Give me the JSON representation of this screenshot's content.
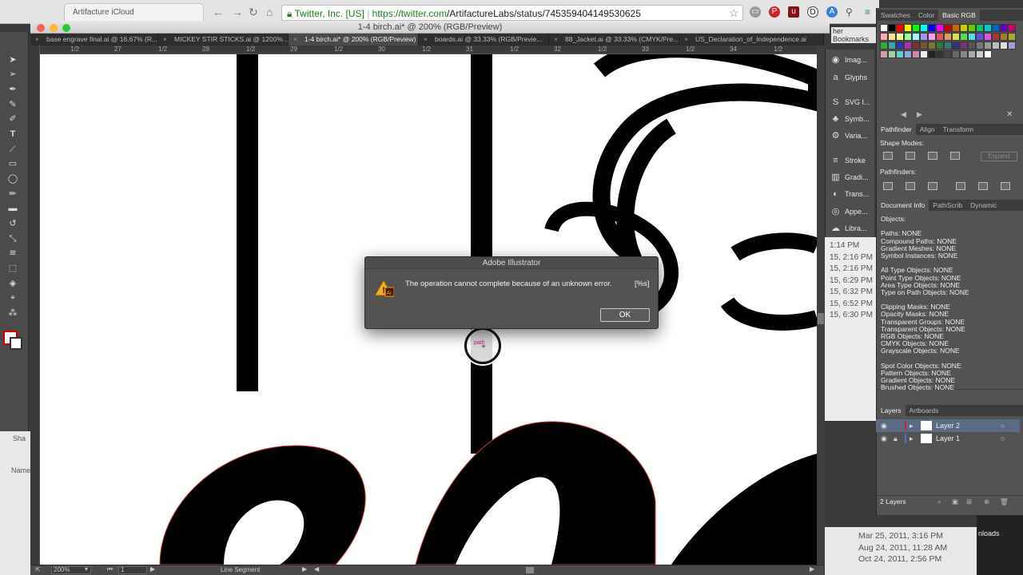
{
  "browser": {
    "tab_title": "Artifacture iCloud",
    "security_label": "Twitter, Inc. [US]",
    "url_host": "https://twitter.com",
    "url_path": "/ArtifactureLabs/status/745359404149530625",
    "bookmarks_label": "her Bookmarks"
  },
  "app": {
    "window_title": "1-4 birch.ai* @ 200% (RGB/Preview)",
    "doc_tabs": [
      {
        "label": "base engrave final.ai @ 16.67% (R...",
        "active": false
      },
      {
        "label": "MICKEY STIR STICKS.ai @ 1200% ...",
        "active": false
      },
      {
        "label": "1-4 birch.ai* @ 200% (RGB/Preview)",
        "active": true
      },
      {
        "label": "boards.ai @ 33.33% (RGB/Previe...",
        "active": false
      },
      {
        "label": "88_Jacket.ai @ 33.33% (CMYK/Pre...",
        "active": false
      },
      {
        "label": "US_Declaration_of_Independence.ai",
        "active": false
      }
    ],
    "ruler_labels": [
      "1/2",
      "27",
      "1/2",
      "28",
      "1/2",
      "29",
      "1/2",
      "30",
      "1/2",
      "31",
      "1/2",
      "32",
      "1/2",
      "33",
      "1/2",
      "34",
      "1/2"
    ]
  },
  "status": {
    "zoom": "200%",
    "artboard": "1",
    "tool_info": "Line Segment"
  },
  "collapsed_panels": [
    {
      "label": "Imag...",
      "icon": "image-icon"
    },
    {
      "label": "Glyphs",
      "icon": "glyphs-icon"
    },
    {
      "label": "SVG I...",
      "icon": "svg-icon"
    },
    {
      "label": "Symb...",
      "icon": "symbols-icon"
    },
    {
      "label": "Varia...",
      "icon": "variables-icon"
    },
    {
      "label": "Stroke",
      "icon": "stroke-icon"
    },
    {
      "label": "Gradi...",
      "icon": "gradient-icon"
    },
    {
      "label": "Trans...",
      "icon": "transparency-icon"
    },
    {
      "label": "Appe...",
      "icon": "appearance-icon"
    },
    {
      "label": "Libra...",
      "icon": "libraries-icon"
    }
  ],
  "finder_times": [
    "1:14 PM",
    "15, 2:16 PM",
    "15, 2:16 PM",
    "15, 6:29 PM",
    "15, 6:32 PM",
    "15, 6:52 PM",
    "15, 6:30 PM"
  ],
  "finder_bottom": [
    "Mar 25, 2011, 3:16 PM",
    "Aug 24, 2011, 11:28 AM",
    "Oct 24, 2011, 2:56 PM"
  ],
  "finder_downloads": "nloads",
  "swatches": {
    "tabs": [
      "Swatches",
      "Color",
      "Basic RGB"
    ]
  },
  "pathfinder": {
    "tabs": [
      "Pathfinder",
      "Align",
      "Transform"
    ],
    "shape_modes_label": "Shape Modes:",
    "pathfinders_label": "Pathfinders:",
    "expand_label": "Expand"
  },
  "docinfo": {
    "tabs": [
      "Document Info",
      "PathScrib",
      "Dynamic"
    ],
    "lines": [
      "Objects:",
      "",
      "Paths: NONE",
      "Compound Paths: NONE",
      "Gradient Meshes: NONE",
      "Symbol Instances: NONE",
      "",
      "All Type Objects: NONE",
      "Point Type Objects: NONE",
      "Area Type Objects: NONE",
      "Type on Path Objects: NONE",
      "",
      "Clipping Masks: NONE",
      "Opacity Masks: NONE",
      "Transparent Groups: NONE",
      "Transparent Objects: NONE",
      "RGB Objects: NONE",
      "CMYK Objects: NONE",
      "Grayscale Objects: NONE",
      "",
      "Spot Color Objects: NONE",
      "Pattern Objects: NONE",
      "Gradient Objects: NONE",
      "Brushed Objects: NONE"
    ]
  },
  "layers": {
    "tabs": [
      "Layers",
      "Artboards"
    ],
    "items": [
      {
        "name": "Layer 2",
        "color": "#c0283a",
        "selected": true
      },
      {
        "name": "Layer 1",
        "color": "#4f6de0",
        "selected": false
      }
    ],
    "count": "2 Layers"
  },
  "dialog": {
    "title": "Adobe Illustrator",
    "message": "The operation cannot complete because of an unknown error.",
    "code": "[%s]",
    "ok_label": "OK"
  },
  "cursor_label": "path",
  "finder_side": {
    "share": "Sha",
    "name_col": "Name"
  },
  "colors": {
    "accent": "#4a90d9",
    "warning": "#f2b01e"
  }
}
